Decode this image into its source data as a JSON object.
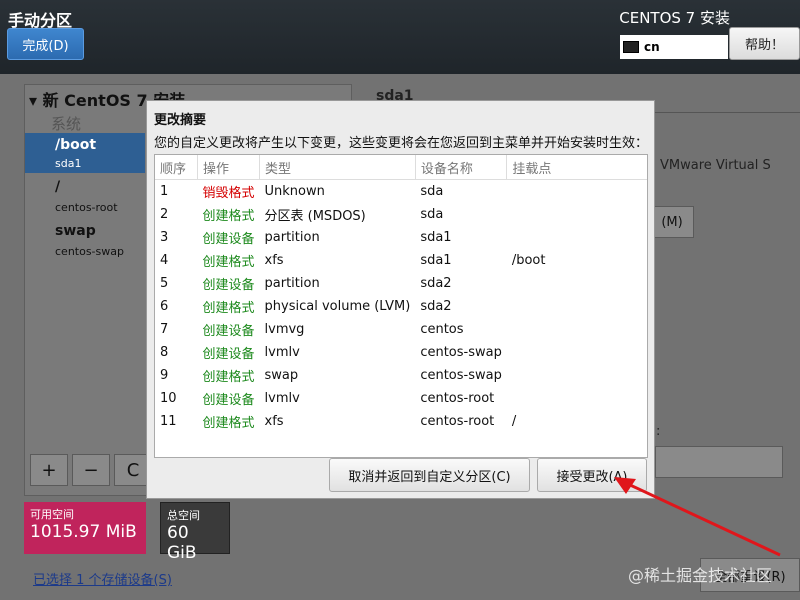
{
  "header": {
    "title": "手动分区",
    "done_label": "完成(D)",
    "installer_title": "CENTOS 7 安装",
    "keyboard_layout": "cn",
    "help_label": "帮助！"
  },
  "left_panel": {
    "heading": "新 CentOS 7 安装",
    "system_label": "系统",
    "mount_points": [
      {
        "name": "/boot",
        "device": "sda1"
      },
      {
        "name": "/",
        "device": "centos-root"
      },
      {
        "name": "swap",
        "device": "centos-swap"
      }
    ],
    "toolbar": {
      "add": "+",
      "remove": "−",
      "refresh": "C"
    }
  },
  "space": {
    "available_label": "可用空间",
    "available_value": "1015.97 MiB",
    "total_label": "总空间",
    "total_value": "60 GiB",
    "available_color": "#c0245c",
    "total_color": "#3a3a3a"
  },
  "storage_link": "已选择 1 个存储设备(S)",
  "right_panel": {
    "device_label": "sda1",
    "vmware_text": "VMware Virtual S",
    "m_button": "(M)",
    "colon": ":",
    "reset_label": "全部重设(R)"
  },
  "dialog": {
    "title": "更改摘要",
    "description": "您的自定义更改将产生以下变更，这些变更将会在您返回到主菜单并开始安装时生效：",
    "columns": [
      "顺序",
      "操作",
      "类型",
      "设备名称",
      "挂载点"
    ],
    "rows": [
      {
        "order": "1",
        "action": "销毁格式",
        "type": "Unknown",
        "device": "sda",
        "mount": "",
        "action_kind": "destroy"
      },
      {
        "order": "2",
        "action": "创建格式",
        "type": "分区表 (MSDOS)",
        "device": "sda",
        "mount": "",
        "action_kind": "create"
      },
      {
        "order": "3",
        "action": "创建设备",
        "type": "partition",
        "device": "sda1",
        "mount": "",
        "action_kind": "create"
      },
      {
        "order": "4",
        "action": "创建格式",
        "type": "xfs",
        "device": "sda1",
        "mount": "/boot",
        "action_kind": "create"
      },
      {
        "order": "5",
        "action": "创建设备",
        "type": "partition",
        "device": "sda2",
        "mount": "",
        "action_kind": "create"
      },
      {
        "order": "6",
        "action": "创建格式",
        "type": "physical volume (LVM)",
        "device": "sda2",
        "mount": "",
        "action_kind": "create"
      },
      {
        "order": "7",
        "action": "创建设备",
        "type": "lvmvg",
        "device": "centos",
        "mount": "",
        "action_kind": "create"
      },
      {
        "order": "8",
        "action": "创建设备",
        "type": "lvmlv",
        "device": "centos-swap",
        "mount": "",
        "action_kind": "create"
      },
      {
        "order": "9",
        "action": "创建格式",
        "type": "swap",
        "device": "centos-swap",
        "mount": "",
        "action_kind": "create"
      },
      {
        "order": "10",
        "action": "创建设备",
        "type": "lvmlv",
        "device": "centos-root",
        "mount": "",
        "action_kind": "create"
      },
      {
        "order": "11",
        "action": "创建格式",
        "type": "xfs",
        "device": "centos-root",
        "mount": "/",
        "action_kind": "create"
      }
    ],
    "cancel_label": "取消并返回到自定义分区(C)",
    "accept_label": "接受更改(A)",
    "colors": {
      "destroy": "#d40000",
      "create": "#1e8a1e"
    }
  },
  "annotation": {
    "arrow_color": "#e0161b"
  },
  "watermark": "@稀土掘金技术社区"
}
